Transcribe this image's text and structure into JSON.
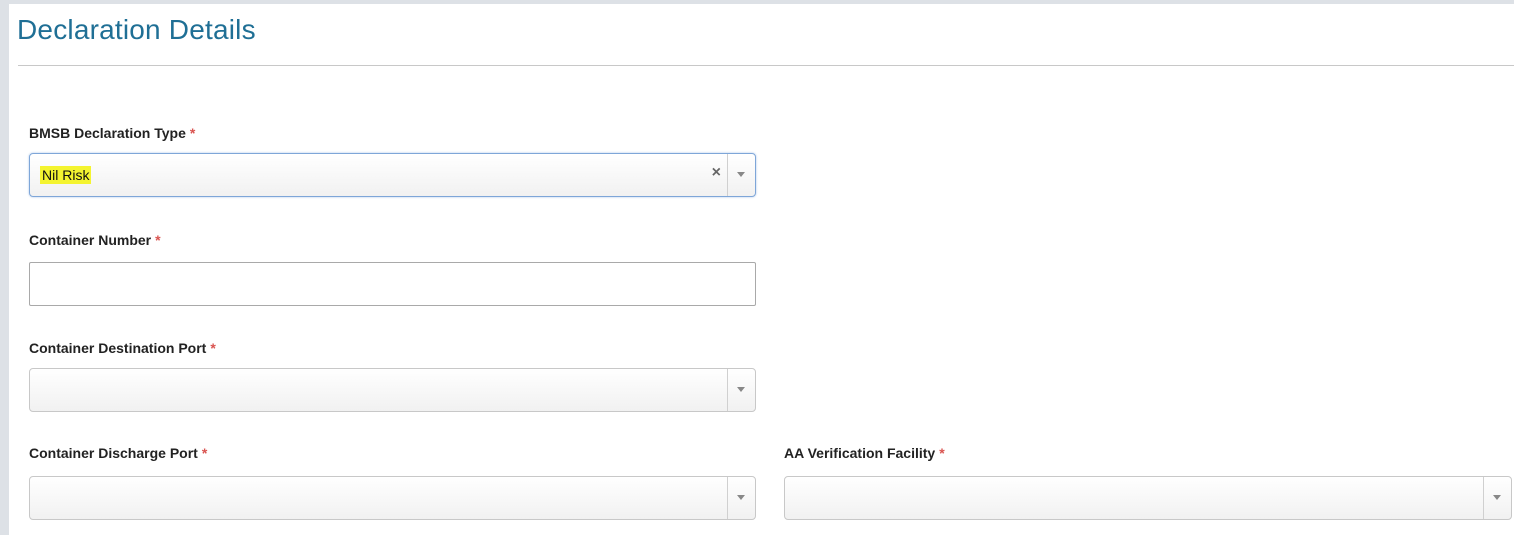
{
  "header": {
    "title": "Declaration Details"
  },
  "fields": {
    "bmsb_type": {
      "label": "BMSB Declaration Type",
      "required_mark": "*",
      "value": "Nil Risk",
      "clear_symbol": "×"
    },
    "container_number": {
      "label": "Container Number",
      "required_mark": "*",
      "value": ""
    },
    "destination_port": {
      "label": "Container Destination Port",
      "required_mark": "*",
      "value": ""
    },
    "discharge_port": {
      "label": "Container Discharge Port",
      "required_mark": "*",
      "value": ""
    },
    "aa_facility": {
      "label": "AA Verification Facility",
      "required_mark": "*",
      "value": ""
    }
  },
  "colors": {
    "title": "#1f6f95",
    "required": "#d9534f",
    "highlight": "#f4f430"
  }
}
